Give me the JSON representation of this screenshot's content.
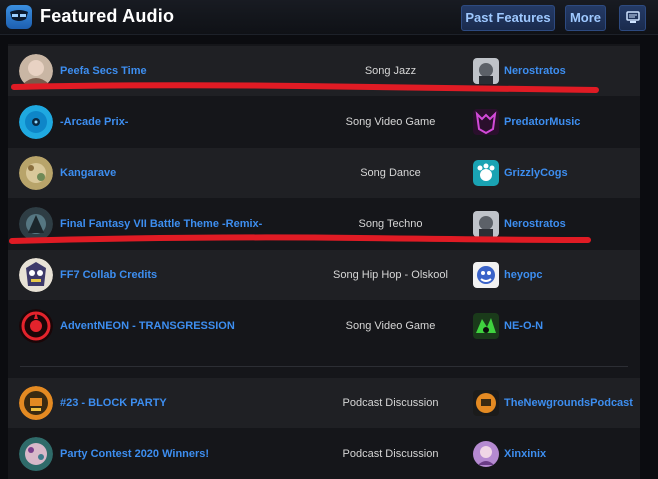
{
  "header": {
    "title": "Featured Audio",
    "past_features_label": "Past Features",
    "more_label": "More",
    "logo_icon": "newgrounds-logo-icon",
    "menu_icon": "menu-icon"
  },
  "colors": {
    "link": "#3d8ef0",
    "accent_red": "#e01b24",
    "row_dark": "#1f2024",
    "row_light": "#15161a"
  },
  "items": [
    {
      "title": "Peefa Secs Time",
      "genre": "Song Jazz",
      "user": "Nerostratos"
    },
    {
      "title": "-Arcade Prix-",
      "genre": "Song Video Game",
      "user": "PredatorMusic"
    },
    {
      "title": "Kangarave",
      "genre": "Song Dance",
      "user": "GrizzlyCogs"
    },
    {
      "title": "Final Fantasy VII Battle Theme -Remix-",
      "genre": "Song Techno",
      "user": "Nerostratos"
    },
    {
      "title": "FF7 Collab Credits",
      "genre": "Song Hip Hop - Olskool",
      "user": "heyopc"
    },
    {
      "title": "AdventNEON - TRANSGRESSION",
      "genre": "Song Video Game",
      "user": "NE-O-N"
    }
  ],
  "podcasts": [
    {
      "title": "#23 - BLOCK PARTY",
      "genre": "Podcast Discussion",
      "user": "TheNewgroundsPodcast"
    },
    {
      "title": "Party Contest 2020 Winners!",
      "genre": "Podcast Discussion",
      "user": "Xinxinix"
    }
  ]
}
